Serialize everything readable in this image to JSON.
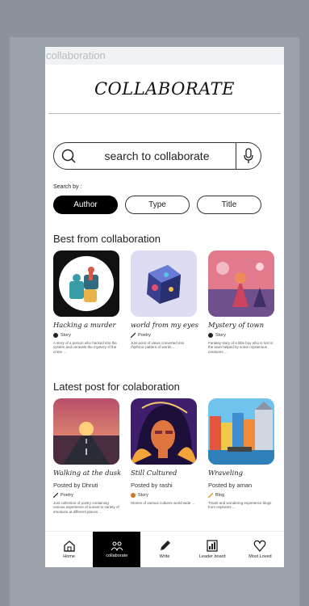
{
  "browser_tab": "collaboration",
  "app_title": "COLLABORATE",
  "search": {
    "placeholder": "search to collaborate"
  },
  "filters": {
    "label": "Search by :",
    "options": [
      "Author",
      "Type",
      "Title"
    ],
    "selected": "Author"
  },
  "best_section": {
    "title": "Best from collaboration",
    "cards": [
      {
        "title": "Hacking a murder",
        "type": "Story",
        "description": "A story of a person who hacked into the system and unravels the mystery of the crime ..."
      },
      {
        "title": "world from my eyes",
        "type": "Poetry",
        "description": "Just point of views converted into rhythmic pattern of words ..."
      },
      {
        "title": "Mystery of town",
        "type": "Story",
        "description": "Fantasy story of a little boy who is lost in the town helped by some mysterious creatures ..."
      }
    ]
  },
  "latest_section": {
    "title": "Latest post for colaboration",
    "cards": [
      {
        "title": "Walking at the dusk",
        "posted_by": "Posted by Dhruti",
        "type": "Poetry",
        "description": "Just collection of poetry containing various experience of sunset to variety of emotions at different places ..."
      },
      {
        "title": "Still Cultured",
        "posted_by": "Posted by rashi",
        "type": "Story",
        "description": "Stories of various cultures world wide ..."
      },
      {
        "title": "Wraveling",
        "posted_by": "Posted by aman",
        "type": "Blog",
        "description": "Travel and wondering experience blogs from explorers ..."
      }
    ]
  },
  "bottom_nav": {
    "items": [
      "Home",
      "collaborate",
      "Write",
      "Leader board",
      "Most Loved"
    ],
    "active": "collaborate"
  },
  "colors": {
    "accent": "#000000",
    "background": "#8b929b"
  }
}
